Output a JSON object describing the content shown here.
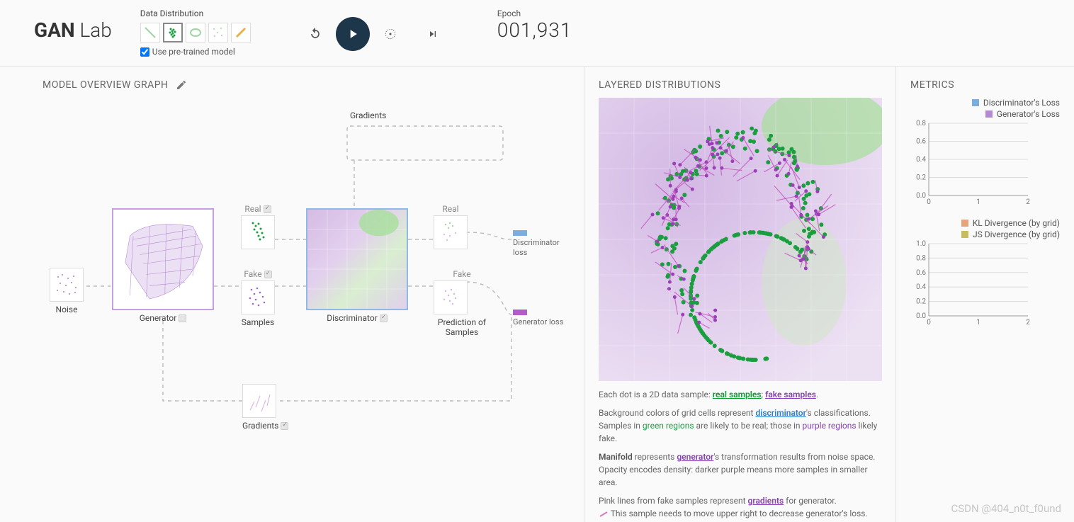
{
  "header": {
    "logo_bold": "GAN",
    "logo_light": " Lab",
    "data_dist_label": "Data Distribution",
    "pretrain_label": "Use pre-trained model",
    "pretrain_checked": true,
    "distributions": [
      {
        "id": "line",
        "selected": false
      },
      {
        "id": "cluster",
        "selected": true
      },
      {
        "id": "ring",
        "selected": false
      },
      {
        "id": "scatter",
        "selected": false
      },
      {
        "id": "diag",
        "selected": false
      }
    ],
    "epoch_label": "Epoch",
    "epoch_value": "001,931"
  },
  "overview": {
    "title": "MODEL OVERVIEW GRAPH",
    "gradients_top": "Gradients",
    "noise": "Noise",
    "generator": "Generator",
    "real": "Real",
    "fake": "Fake",
    "samples": "Samples",
    "discriminator": "Discriminator",
    "prediction": "Prediction of Samples",
    "gradients_bottom": "Gradients",
    "disc_loss": "Discriminator loss",
    "gen_loss": "Generator loss"
  },
  "layered": {
    "title": "LAYERED DISTRIBUTIONS",
    "intro_prefix": "Each dot is a 2D data sample: ",
    "real_samples": "real samples",
    "fake_samples": "fake samples",
    "sep": "; ",
    "p2a": "Background colors of grid cells represent ",
    "discriminator": "discriminator",
    "p2b": "'s classifications.",
    "p2c_pre": "Samples in ",
    "green_regions": "green regions",
    "p2c_mid": " are likely to be real; those in ",
    "purple_regions": "purple regions",
    "p2c_post": " likely fake.",
    "p3a": "Manifold",
    "p3b": " represents ",
    "generator": "generator",
    "p3c": "'s transformation results from noise space.",
    "p3d": "Opacity encodes density: darker purple means more samples in smaller area.",
    "p4a": "Pink lines from fake samples represent ",
    "gradients": "gradients",
    "p4b": " for generator.",
    "p4c": "This sample needs to move upper right to decrease generator's loss."
  },
  "metrics": {
    "title": "METRICS",
    "disc_loss": "Discriminator's Loss",
    "gen_loss": "Generator's Loss",
    "kl": "KL Divergence (by grid)",
    "js": "JS Divergence (by grid)"
  },
  "watermark": "CSDN @404_n0t_f0und",
  "chart_data": [
    {
      "type": "line",
      "title": "loss_chart",
      "xlabel": "",
      "ylabel": "",
      "x": [
        0,
        1,
        2
      ],
      "xlim": [
        0,
        2
      ],
      "ylim": [
        0,
        0.8
      ],
      "yticks": [
        0.0,
        0.2,
        0.4,
        0.6,
        0.8
      ],
      "series": [
        {
          "name": "Discriminator's Loss",
          "color": "#7daedb",
          "values": []
        },
        {
          "name": "Generator's Loss",
          "color": "#b58ad0",
          "values": []
        }
      ]
    },
    {
      "type": "line",
      "title": "divergence_chart",
      "xlabel": "",
      "ylabel": "",
      "x": [
        0,
        1,
        2
      ],
      "xlim": [
        0,
        2
      ],
      "ylim": [
        0,
        1.0
      ],
      "yticks": [
        0.0,
        0.2,
        0.4,
        0.6,
        0.8,
        1.0
      ],
      "series": [
        {
          "name": "KL Divergence (by grid)",
          "color": "#e6a578",
          "values": []
        },
        {
          "name": "JS Divergence (by grid)",
          "color": "#c9bc5a",
          "values": []
        }
      ]
    }
  ]
}
